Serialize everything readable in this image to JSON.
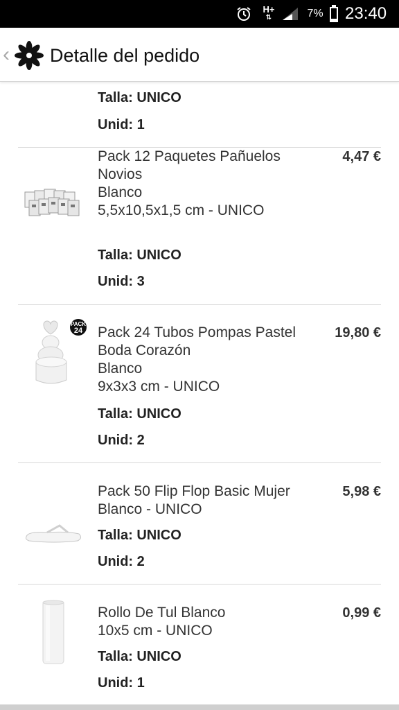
{
  "status_bar": {
    "network": "H+",
    "battery_percent": "7%",
    "time": "23:40"
  },
  "header": {
    "title": "Detalle del pedido"
  },
  "labels": {
    "size_label": "Talla:",
    "units_label": "Unid:"
  },
  "items": [
    {
      "name": "",
      "price": "",
      "size": "UNICO",
      "units": "1",
      "thumb_icon": ""
    },
    {
      "name_lines": [
        "Pack 12 Paquetes Pañuelos",
        "Novios",
        "Blanco",
        "5,5x10,5x1,5 cm - UNICO"
      ],
      "price": "4,47 €",
      "size": "UNICO",
      "units": "3",
      "thumb_icon": "tissue-packs-image"
    },
    {
      "name_lines": [
        "Pack 24 Tubos Pompas Pastel",
        "Boda Corazón",
        "Blanco",
        "9x3x3 cm - UNICO"
      ],
      "price": "19,80 €",
      "size": "UNICO",
      "units": "2",
      "thumb_icon": "bubble-tube-image",
      "badge_top": "PACK",
      "badge_num": "24"
    },
    {
      "name_lines": [
        "Pack 50 Flip Flop Basic Mujer",
        "Blanco - UNICO"
      ],
      "price": "5,98 €",
      "size": "UNICO",
      "units": "2",
      "thumb_icon": "flip-flop-image"
    },
    {
      "name_lines": [
        "Rollo De Tul Blanco",
        "10x5 cm - UNICO"
      ],
      "price": "0,99 €",
      "size": "UNICO",
      "units": "1",
      "thumb_icon": "tulle-roll-image"
    }
  ]
}
